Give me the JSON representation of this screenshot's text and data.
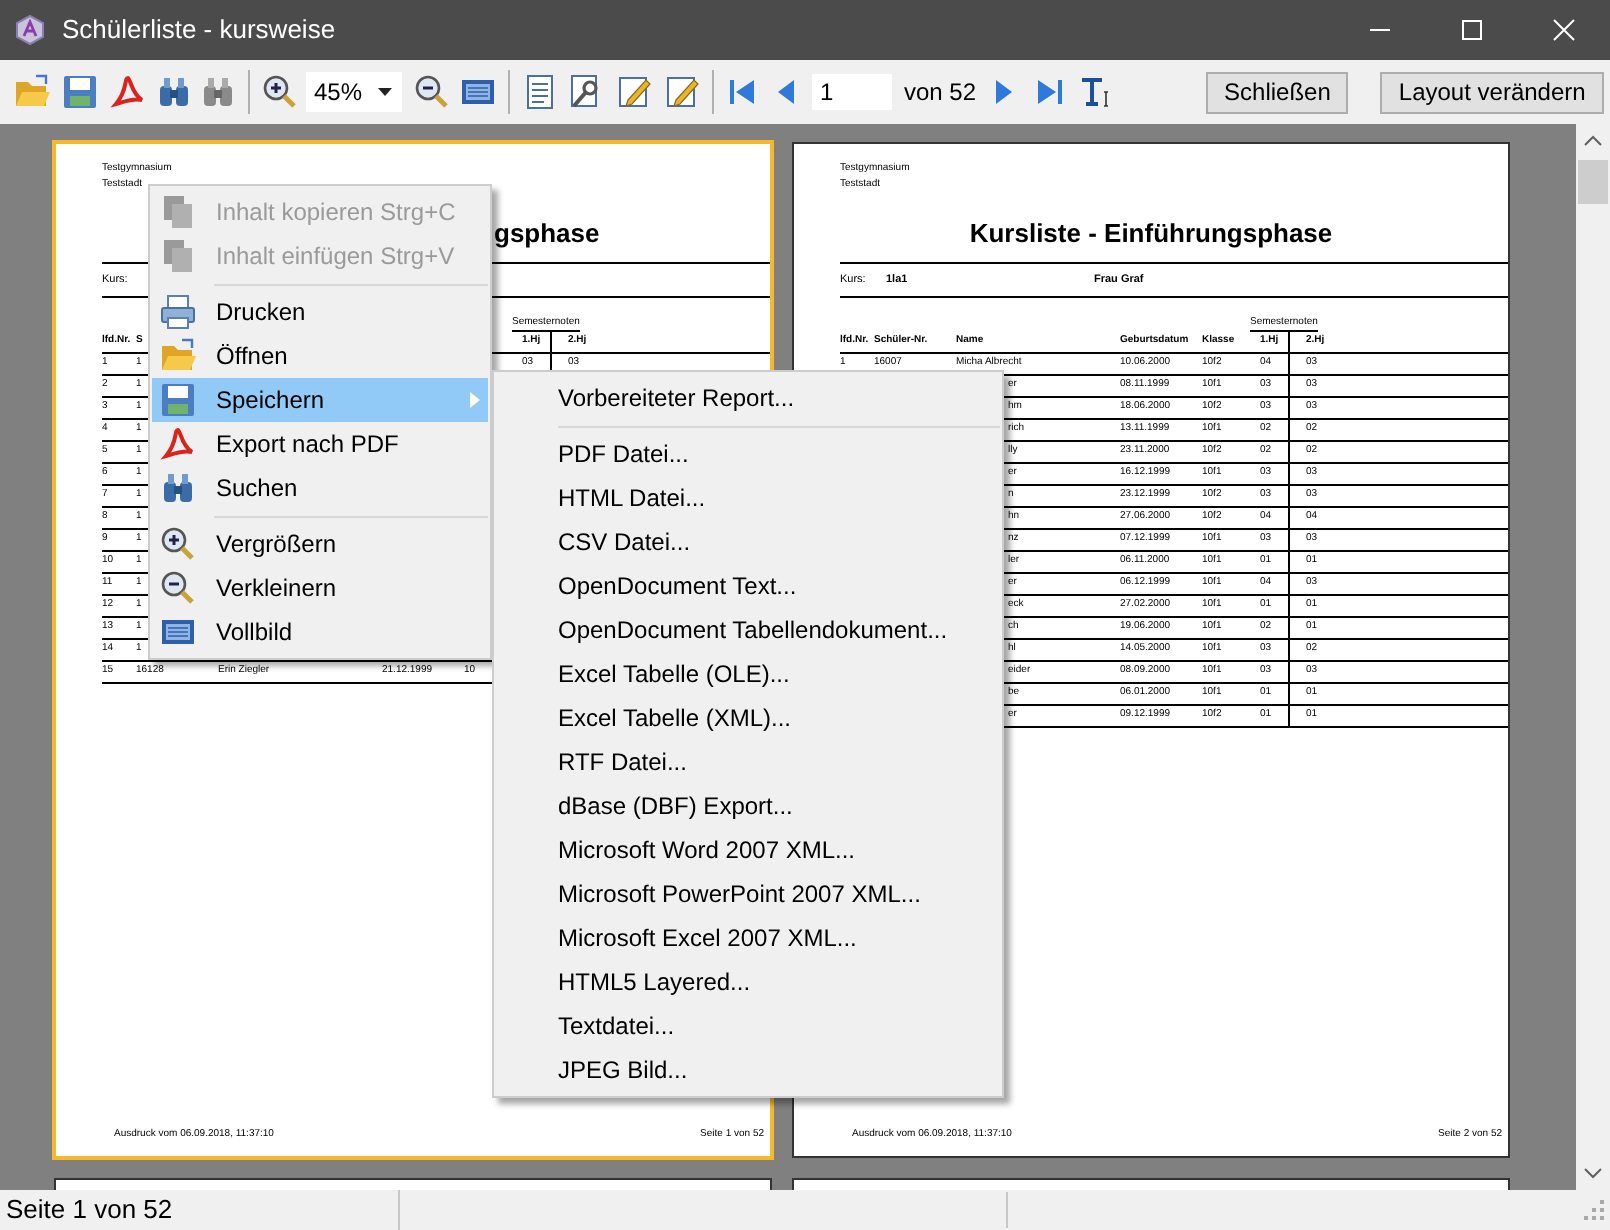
{
  "window": {
    "title": "Schülerliste - kursweise"
  },
  "toolbar": {
    "zoom": "45%",
    "page": "1",
    "page_total": "von 52",
    "buttons": [
      "Schließen",
      "Layout verändern"
    ]
  },
  "pages": [
    {
      "selected": true,
      "title_clipped": true,
      "header": [
        "Testgymnasium",
        "Teststadt"
      ],
      "title": "gsphase",
      "course": {
        "label": "Kurs:"
      },
      "group_header": "Semesternoten",
      "columns": {
        "no": "lfd.Nr.",
        "student_no": "S",
        "hj1": "1.Hj",
        "hj2": "2.Hj"
      },
      "rows": [
        {
          "no": "1",
          "student_no": "1",
          "hj1": "03",
          "hj2": "03"
        },
        {
          "no": "2",
          "student_no": "1"
        },
        {
          "no": "3",
          "student_no": "1"
        },
        {
          "no": "4",
          "student_no": "1"
        },
        {
          "no": "5",
          "student_no": "1"
        },
        {
          "no": "6",
          "student_no": "1"
        },
        {
          "no": "7",
          "student_no": "1"
        },
        {
          "no": "8",
          "student_no": "1"
        },
        {
          "no": "9",
          "student_no": "1"
        },
        {
          "no": "10",
          "student_no": "1"
        },
        {
          "no": "11",
          "student_no": "1"
        },
        {
          "no": "12",
          "student_no": "1"
        },
        {
          "no": "13",
          "student_no": "1"
        },
        {
          "no": "14",
          "student_no": "1"
        },
        {
          "no": "15",
          "student_no": "16128",
          "name": "Erin Ziegler",
          "birth": "21.12.1999",
          "class": "10"
        }
      ],
      "footer": {
        "left": "Ausdruck vom 06.09.2018, 11:37:10",
        "right": "Seite 1 von 52"
      }
    },
    {
      "selected": false,
      "title_clipped": false,
      "header": [
        "Testgymnasium",
        "Teststadt"
      ],
      "title": "Kursliste - Einführungsphase",
      "course": {
        "label": "Kurs:",
        "code": "1la1",
        "teacher": "Frau Graf"
      },
      "group_header": "Semesternoten",
      "columns": {
        "no": "lfd.Nr.",
        "student_no": "Schüler-Nr.",
        "name": "Name",
        "birth": "Geburtsdatum",
        "class": "Klasse",
        "hj1": "1.Hj",
        "hj2": "2.Hj"
      },
      "rows": [
        {
          "no": "1",
          "student_no": "16007",
          "name": "Micha Albrecht",
          "birth": "10.06.2000",
          "class": "10f2",
          "hj1": "04",
          "hj2": "03"
        },
        {
          "name_tail": "er",
          "birth": "08.11.1999",
          "class": "10f1",
          "hj1": "03",
          "hj2": "03"
        },
        {
          "name_tail": "hm",
          "birth": "18.06.2000",
          "class": "10f2",
          "hj1": "03",
          "hj2": "03"
        },
        {
          "name_tail": "rich",
          "birth": "13.11.1999",
          "class": "10f1",
          "hj1": "02",
          "hj2": "02"
        },
        {
          "name_tail": "lly",
          "birth": "23.11.2000",
          "class": "10f2",
          "hj1": "02",
          "hj2": "02"
        },
        {
          "name_tail": "er",
          "birth": "16.12.1999",
          "class": "10f1",
          "hj1": "03",
          "hj2": "03"
        },
        {
          "name_tail": "n",
          "birth": "23.12.1999",
          "class": "10f2",
          "hj1": "03",
          "hj2": "03"
        },
        {
          "name_tail": "hn",
          "birth": "27.06.2000",
          "class": "10f2",
          "hj1": "04",
          "hj2": "04"
        },
        {
          "name_tail": "nz",
          "birth": "07.12.1999",
          "class": "10f1",
          "hj1": "03",
          "hj2": "03"
        },
        {
          "name_tail": "ler",
          "birth": "06.11.2000",
          "class": "10f1",
          "hj1": "01",
          "hj2": "01"
        },
        {
          "name_tail": "er",
          "birth": "06.12.1999",
          "class": "10f1",
          "hj1": "04",
          "hj2": "03"
        },
        {
          "name_tail": "eck",
          "birth": "27.02.2000",
          "class": "10f1",
          "hj1": "01",
          "hj2": "01"
        },
        {
          "name_tail": "ch",
          "birth": "19.06.2000",
          "class": "10f1",
          "hj1": "02",
          "hj2": "01"
        },
        {
          "name_tail": "hl",
          "birth": "14.05.2000",
          "class": "10f1",
          "hj1": "03",
          "hj2": "02"
        },
        {
          "name_tail": "eider",
          "birth": "08.09.2000",
          "class": "10f1",
          "hj1": "03",
          "hj2": "03"
        },
        {
          "name_tail": "be",
          "birth": "06.01.2000",
          "class": "10f1",
          "hj1": "01",
          "hj2": "01"
        },
        {
          "name_tail": "er",
          "birth": "09.12.1999",
          "class": "10f2",
          "hj1": "01",
          "hj2": "01"
        }
      ],
      "footer": {
        "left": "Ausdruck vom 06.09.2018, 11:37:10",
        "right": "Seite 2 von 52"
      }
    }
  ],
  "context_menu": [
    {
      "kind": "item",
      "label": "Inhalt kopieren",
      "shortcut": "Strg+C",
      "disabled": true,
      "selected": false,
      "submenu": false
    },
    {
      "kind": "item",
      "label": "Inhalt einfügen",
      "shortcut": "Strg+V",
      "disabled": true,
      "selected": false,
      "submenu": false
    },
    {
      "kind": "separator"
    },
    {
      "kind": "item",
      "label": "Drucken",
      "disabled": false,
      "selected": false,
      "submenu": false
    },
    {
      "kind": "item",
      "label": "Öffnen",
      "disabled": false,
      "selected": false,
      "submenu": false
    },
    {
      "kind": "item",
      "label": "Speichern",
      "disabled": false,
      "selected": true,
      "submenu": true
    },
    {
      "kind": "item",
      "label": "Export nach PDF",
      "disabled": false,
      "selected": false,
      "submenu": false
    },
    {
      "kind": "item",
      "label": "Suchen",
      "disabled": false,
      "selected": false,
      "submenu": false
    },
    {
      "kind": "separator"
    },
    {
      "kind": "item",
      "label": "Vergrößern",
      "disabled": false,
      "selected": false,
      "submenu": false
    },
    {
      "kind": "item",
      "label": "Verkleinern",
      "disabled": false,
      "selected": false,
      "submenu": false
    },
    {
      "kind": "item",
      "label": "Vollbild",
      "disabled": false,
      "selected": false,
      "submenu": false
    }
  ],
  "submenu": [
    {
      "kind": "item",
      "label": "Vorbereiteter Report..."
    },
    {
      "kind": "separator"
    },
    {
      "kind": "item",
      "label": "PDF Datei..."
    },
    {
      "kind": "item",
      "label": "HTML Datei..."
    },
    {
      "kind": "item",
      "label": "CSV Datei..."
    },
    {
      "kind": "item",
      "label": "OpenDocument Text..."
    },
    {
      "kind": "item",
      "label": "OpenDocument Tabellendokument..."
    },
    {
      "kind": "item",
      "label": "Excel Tabelle (OLE)..."
    },
    {
      "kind": "item",
      "label": "Excel Tabelle (XML)..."
    },
    {
      "kind": "item",
      "label": "RTF Datei..."
    },
    {
      "kind": "item",
      "label": "dBase (DBF) Export..."
    },
    {
      "kind": "item",
      "label": "Microsoft Word 2007 XML..."
    },
    {
      "kind": "item",
      "label": "Microsoft PowerPoint 2007 XML..."
    },
    {
      "kind": "item",
      "label": "Microsoft Excel 2007 XML..."
    },
    {
      "kind": "item",
      "label": "HTML5 Layered..."
    },
    {
      "kind": "item",
      "label": "Textdatei..."
    },
    {
      "kind": "item",
      "label": "JPEG Bild..."
    }
  ],
  "status_bar": [
    "Seite 1 von 52"
  ]
}
